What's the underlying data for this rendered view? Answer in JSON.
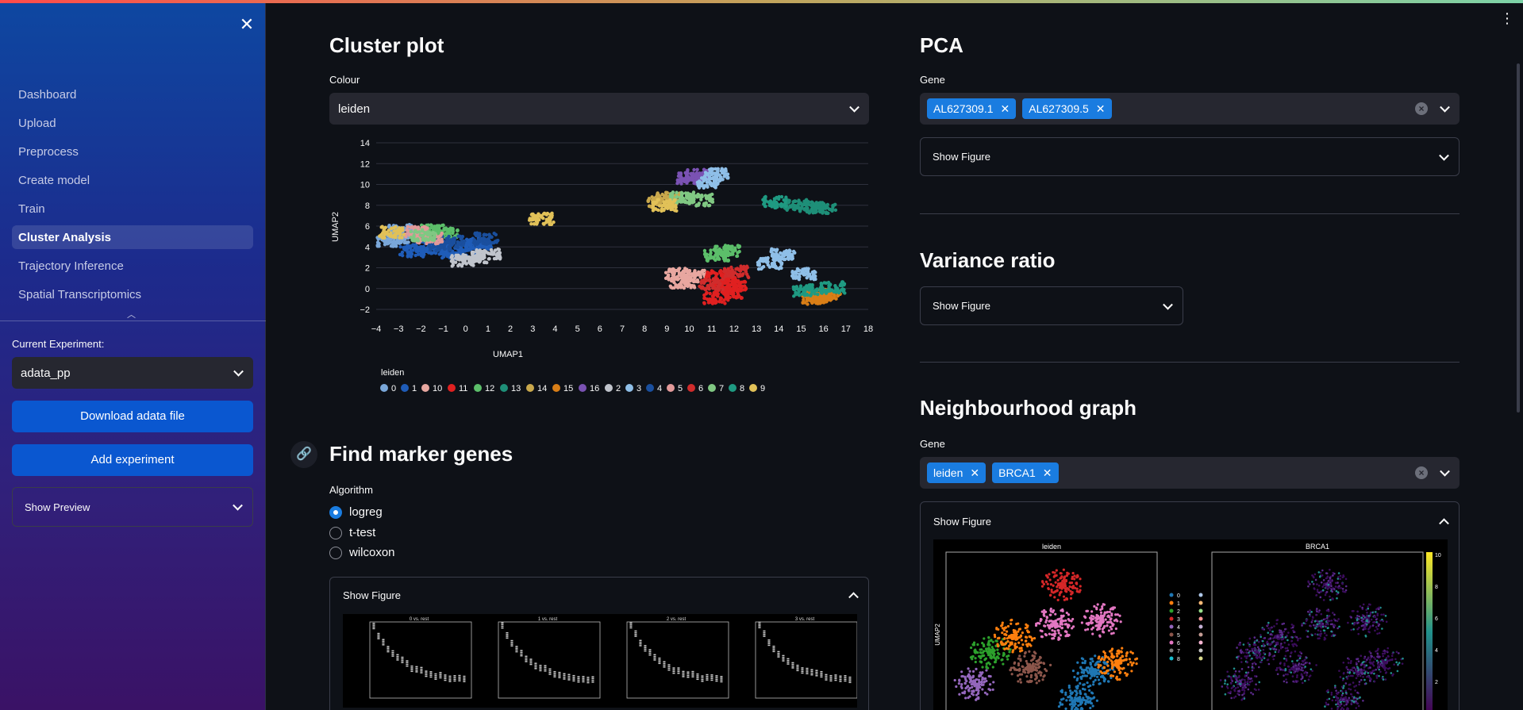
{
  "sidebar": {
    "nav": [
      "Dashboard",
      "Upload",
      "Preprocess",
      "Create model",
      "Train",
      "Cluster Analysis",
      "Trajectory Inference",
      "Spatial Transcriptomics"
    ],
    "active": "Cluster Analysis",
    "current_experiment_label": "Current Experiment:",
    "current_experiment_value": "adata_pp",
    "download_button": "Download adata file",
    "add_experiment_button": "Add experiment",
    "show_preview": "Show Preview"
  },
  "cluster_plot": {
    "title": "Cluster plot",
    "colour_label": "Colour",
    "colour_value": "leiden"
  },
  "chart_data": {
    "type": "scatter",
    "xlabel": "UMAP1",
    "ylabel": "UMAP2",
    "xlim": [
      -4,
      18
    ],
    "ylim": [
      -2,
      14
    ],
    "x_ticks": [
      "−4",
      "−3",
      "−2",
      "−1",
      "0",
      "1",
      "2",
      "3",
      "4",
      "5",
      "6",
      "7",
      "8",
      "9",
      "10",
      "11",
      "12",
      "13",
      "14",
      "15",
      "16",
      "17",
      "18"
    ],
    "y_ticks": [
      "−2",
      "0",
      "2",
      "4",
      "6",
      "8",
      "10",
      "12",
      "14"
    ],
    "grid": true,
    "legend_title": "leiden",
    "legend_position": "bottom",
    "series": [
      {
        "name": "0",
        "color": "#7aa7d9",
        "points": [
          [
            -3.1,
            4.9
          ],
          [
            -2.6,
            5.2
          ],
          [
            -3.4,
            4.6
          ],
          [
            -2.9,
            5.6
          ]
        ]
      },
      {
        "name": "1",
        "color": "#1f5cb8",
        "points": [
          [
            -1.2,
            3.8
          ],
          [
            -0.5,
            3.4
          ],
          [
            0.2,
            3.9
          ],
          [
            -1.8,
            4.1
          ],
          [
            -2.4,
            3.6
          ],
          [
            0.6,
            4.3
          ]
        ]
      },
      {
        "name": "10",
        "color": "#e8a7a0",
        "points": [
          [
            10.2,
            1.2
          ],
          [
            9.7,
            0.6
          ],
          [
            9.5,
            1.4
          ]
        ]
      },
      {
        "name": "11",
        "color": "#e02020",
        "points": [
          [
            11.3,
            1.2
          ],
          [
            11.8,
            -0.4
          ],
          [
            11.6,
            0.6
          ],
          [
            12.0,
            0.2
          ],
          [
            11.2,
            -0.9
          ]
        ]
      },
      {
        "name": "12",
        "color": "#5cbf6a",
        "points": [
          [
            -1.5,
            5.6
          ],
          [
            -0.9,
            5.3
          ],
          [
            11.7,
            3.6
          ],
          [
            11.2,
            3.2
          ]
        ]
      },
      {
        "name": "13",
        "color": "#1e8f78",
        "points": [
          [
            15.5,
            7.8
          ],
          [
            16.0,
            7.7
          ],
          [
            14.8,
            8.0
          ]
        ]
      },
      {
        "name": "14",
        "color": "#c9a84c",
        "points": [
          [
            8.7,
            8.3
          ],
          [
            9.1,
            8.7
          ]
        ]
      },
      {
        "name": "15",
        "color": "#d97e17",
        "points": [
          [
            15.8,
            -0.8
          ],
          [
            16.2,
            -0.6
          ],
          [
            15.6,
            -1.0
          ]
        ]
      },
      {
        "name": "16",
        "color": "#7a52b3",
        "points": [
          [
            10.0,
            10.6
          ],
          [
            10.4,
            10.9
          ]
        ]
      },
      {
        "name": "2",
        "color": "#c0c4cc",
        "points": [
          [
            0.4,
            3.0
          ],
          [
            1.0,
            3.3
          ],
          [
            -0.1,
            2.7
          ]
        ]
      },
      {
        "name": "3",
        "color": "#8fbfe8",
        "points": [
          [
            11.2,
            11.0
          ],
          [
            10.9,
            10.2
          ],
          [
            14.2,
            3.3
          ],
          [
            13.6,
            2.4
          ],
          [
            15.1,
            1.4
          ]
        ]
      },
      {
        "name": "4",
        "color": "#1a4f9e",
        "points": [
          [
            -0.6,
            4.5
          ],
          [
            0.9,
            4.8
          ],
          [
            -1.1,
            4.2
          ]
        ]
      },
      {
        "name": "5",
        "color": "#e39a9a",
        "points": [
          [
            -2.2,
            5.4
          ],
          [
            -1.6,
            4.8
          ]
        ]
      },
      {
        "name": "6",
        "color": "#d02c2c",
        "points": [
          [
            12.1,
            1.6
          ],
          [
            11.0,
            0.4
          ]
        ]
      },
      {
        "name": "7",
        "color": "#80c883",
        "points": [
          [
            9.7,
            8.7
          ],
          [
            10.5,
            8.5
          ],
          [
            -1.9,
            5.1
          ]
        ]
      },
      {
        "name": "8",
        "color": "#1f9a82",
        "points": [
          [
            15.2,
            -0.2
          ],
          [
            16.4,
            0.1
          ],
          [
            13.8,
            8.3
          ]
        ]
      },
      {
        "name": "9",
        "color": "#e1c158",
        "points": [
          [
            8.9,
            8.0
          ],
          [
            3.4,
            6.7
          ],
          [
            -3.3,
            5.4
          ]
        ]
      }
    ]
  },
  "marker": {
    "title": "Find marker genes",
    "algorithm_label": "Algorithm",
    "options": [
      "logreg",
      "t-test",
      "wilcoxon"
    ],
    "selected": "logreg",
    "show_figure": "Show Figure",
    "panels": [
      "0 vs. rest",
      "1 vs. rest",
      "2 vs. rest",
      "3 vs. rest"
    ]
  },
  "pca": {
    "title": "PCA",
    "gene_label": "Gene",
    "chips": [
      "AL627309.1",
      "AL627309.5"
    ],
    "show_figure": "Show Figure"
  },
  "variance": {
    "title": "Variance ratio",
    "show_figure": "Show Figure"
  },
  "neighbourhood": {
    "title": "Neighbourhood graph",
    "gene_label": "Gene",
    "chips": [
      "leiden",
      "BRCA1"
    ],
    "show_figure": "Show Figure",
    "panel_titles": [
      "leiden",
      "BRCA1"
    ],
    "ylabel": "UMAP2",
    "legend": [
      "0",
      "1",
      "2",
      "3",
      "4",
      "5",
      "6",
      "7",
      "8"
    ],
    "colorbar_ticks": [
      "10",
      "8",
      "6",
      "4",
      "2"
    ]
  }
}
